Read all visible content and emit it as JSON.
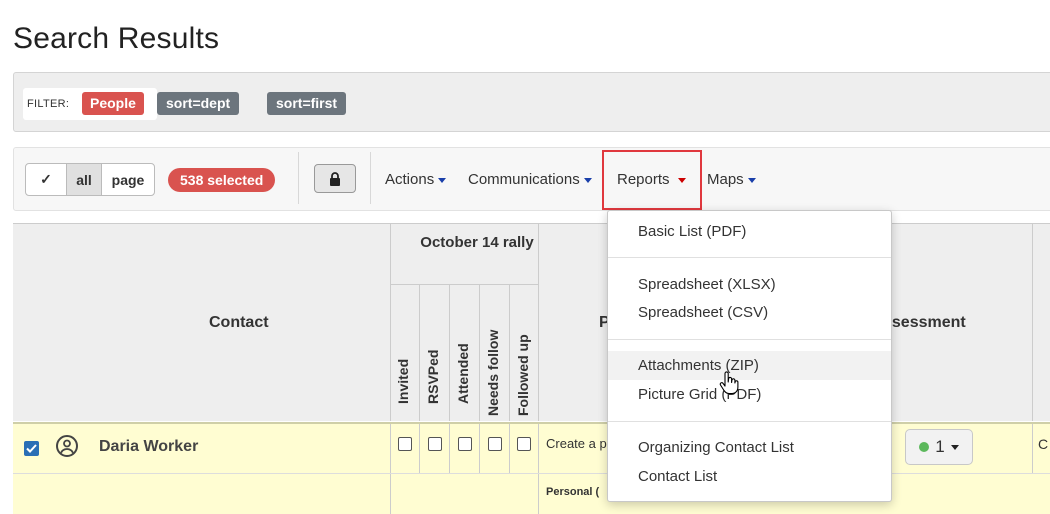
{
  "page": {
    "title": "Search Results"
  },
  "filter": {
    "label": "FILTER:",
    "people": "People",
    "sorts": [
      "sort=dept",
      "sort=first"
    ]
  },
  "toolbar": {
    "select_check": "✓",
    "select_all": "all",
    "select_page": "page",
    "selected_count": "538 selected",
    "menus": {
      "actions": "Actions",
      "communications": "Communications",
      "reports": "Reports",
      "maps": "Maps"
    }
  },
  "table": {
    "headers": {
      "contact": "Contact",
      "group": "October 14 rally",
      "subcolumns": [
        "Invited",
        "RSVPed",
        "Attended",
        "Needs follow",
        "Followed up"
      ],
      "partial_p": "P",
      "assessment": "ssessment"
    },
    "rows": [
      {
        "name": "Daria Worker",
        "text": "Create a p",
        "assessment": "1",
        "edge": "C"
      },
      {
        "text": "Personal ("
      }
    ]
  },
  "dropdown": {
    "groups": [
      [
        "Basic List (PDF)"
      ],
      [
        "Spreadsheet (XLSX)",
        "Spreadsheet (CSV)"
      ],
      [
        "Attachments (ZIP)",
        "Picture Grid (PDF)"
      ],
      [
        "Organizing Contact List",
        "Contact List"
      ]
    ]
  },
  "colors": {
    "accent_red": "#d9534f",
    "pill_gray": "#6c757d",
    "row_highlight": "#fffdd2",
    "link_blue": "#1a3faa"
  },
  "icons": [
    "check-icon",
    "lock-icon",
    "caret-down-icon",
    "user-circle-icon",
    "hand-pointer-cursor-icon"
  ]
}
